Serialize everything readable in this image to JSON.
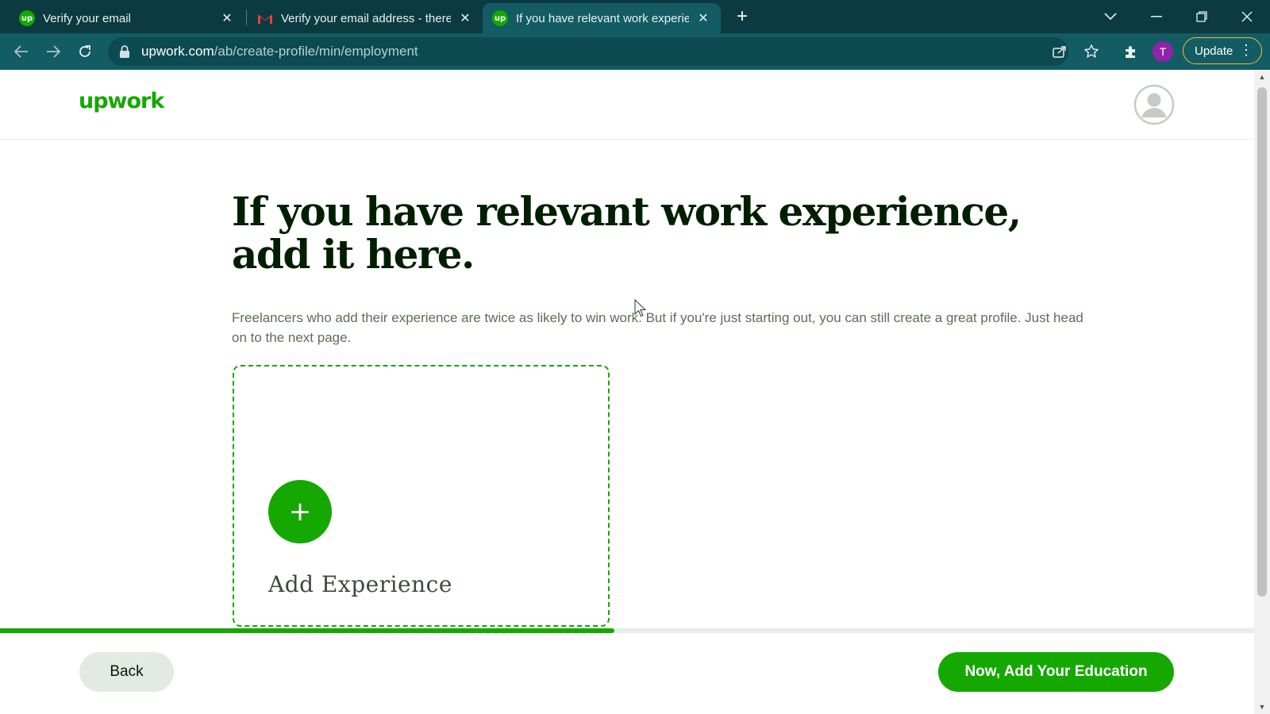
{
  "browser": {
    "tabs": [
      {
        "title": "Verify your email",
        "favicon": "upwork-favicon",
        "active": false
      },
      {
        "title": "Verify your email address - there",
        "favicon": "gmail-favicon",
        "active": false
      },
      {
        "title": "If you have relevant work experie",
        "favicon": "upwork-favicon",
        "active": true
      }
    ],
    "favicon_text": "up",
    "url_host": "upwork.com",
    "url_path": "/ab/create-profile/min/employment",
    "profile_initial": "T",
    "update_label": "Update"
  },
  "header": {
    "logo_text": "upwork"
  },
  "main": {
    "headline_line1": "If you have relevant work experience,",
    "headline_line2": "add it here.",
    "subtext": "Freelancers who add their experience are twice as likely to win work. But if you're just starting out, you can still create a great profile. Just head on to the next page.",
    "add_card_label": "Add Experience"
  },
  "progress": {
    "fraction": 0.49
  },
  "footer": {
    "back_label": "Back",
    "next_label": "Now, Add Your Education"
  },
  "colors": {
    "brand_green": "#14a800",
    "chrome_dark": "#0b3b41",
    "chrome_toolbar": "#135c64"
  }
}
